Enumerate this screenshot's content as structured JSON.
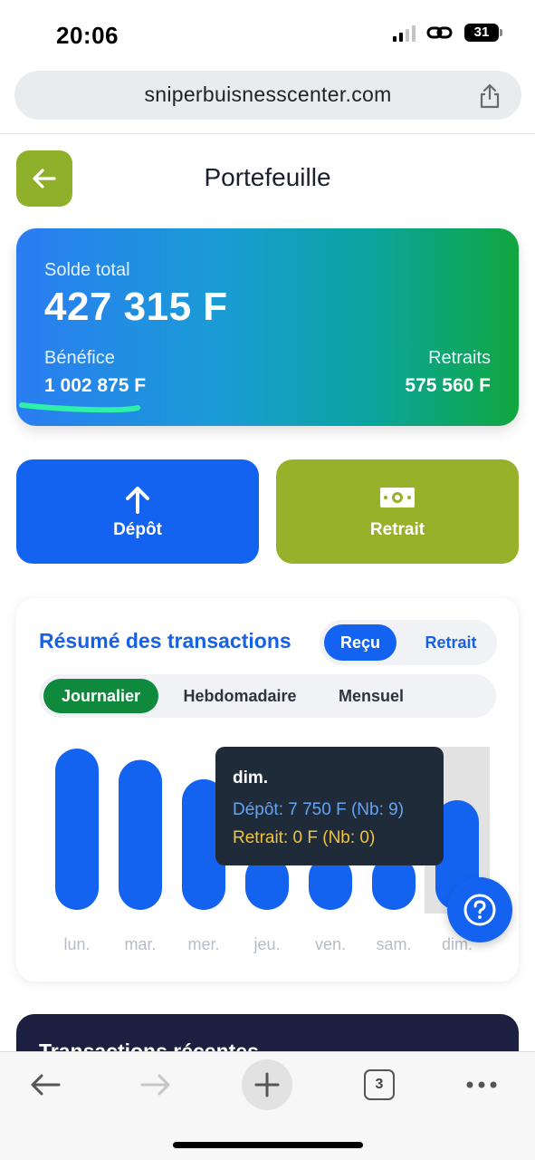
{
  "status_bar": {
    "time": "20:06",
    "battery": "31"
  },
  "browser": {
    "url": "sniperbuisnesscenter.com",
    "tab_count": "3"
  },
  "header": {
    "title": "Portefeuille"
  },
  "balance": {
    "total_label": "Solde total",
    "total_value": "427 315 F",
    "benefice_label": "Bénéfice",
    "benefice_value": "1 002 875 F",
    "retraits_label": "Retraits",
    "retraits_value": "575 560 F"
  },
  "actions": {
    "depot_label": "Dépôt",
    "retrait_label": "Retrait"
  },
  "summary": {
    "title": "Résumé des transactions",
    "toggle": {
      "recu": "Reçu",
      "retrait": "Retrait",
      "selected": "Reçu"
    },
    "periods": [
      "Journalier",
      "Hebdomadaire",
      "Mensuel"
    ],
    "selected_period": "Journalier"
  },
  "chart_data": {
    "type": "bar",
    "categories": [
      "lun.",
      "mar.",
      "mer.",
      "jeu.",
      "ven.",
      "sam.",
      "dim."
    ],
    "values": [
      1.0,
      0.93,
      0.81,
      null,
      null,
      null,
      0.68
    ],
    "highlighted": "dim."
  },
  "tooltip": {
    "title": "dim.",
    "depot": "Dépôt: 7 750 F (Nb: 9)",
    "retrait": "Retrait: 0 F (Nb: 0)"
  },
  "recent": {
    "title": "Transactions récentes"
  },
  "colors": {
    "primary": "#1463f0",
    "olive": "#97b22a",
    "green": "#0f8a3d",
    "tooltip_bg": "#1f2b38",
    "tooltip_depot": "#63a4f5",
    "tooltip_retrait": "#f2c43d"
  }
}
